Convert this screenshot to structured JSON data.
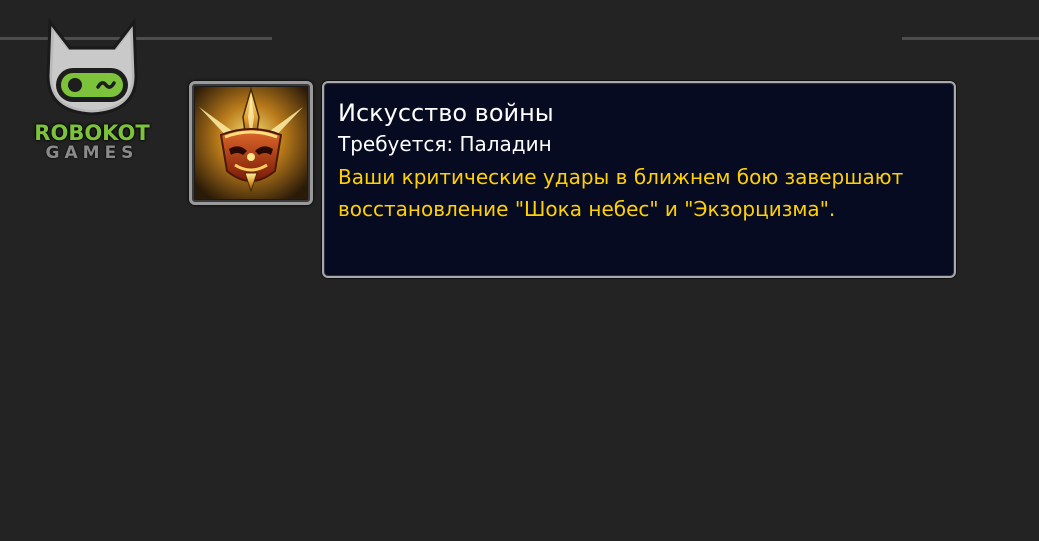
{
  "logo": {
    "line1": "ROBOKOT",
    "line2": "GAMES",
    "icon": "robot-cat-head-icon",
    "accent_color": "#7cc23a"
  },
  "ability": {
    "icon": "art-of-war-helmet-icon",
    "name": "Искусство войны",
    "requirement": "Требуется: Паладин",
    "description": "Ваши критические удары в ближнем бою завершают восстановление \"Шока небес\" и \"Экзорцизма\".",
    "colors": {
      "title": "#ffffff",
      "description": "#ffd100",
      "background": "#070b21",
      "border": "#a9a9a9"
    }
  }
}
